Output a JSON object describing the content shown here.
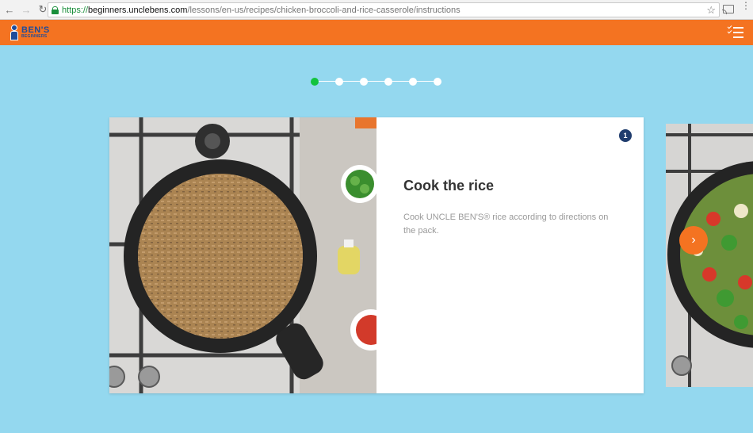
{
  "browser": {
    "back_icon": "arrow-left-icon",
    "forward_icon": "arrow-right-icon",
    "reload_icon": "reload-icon",
    "url_scheme": "https://",
    "url_host": "beginners.unclebens.com",
    "url_path": "/lessons/en-us/recipes/chicken-broccoli-and-rice-casserole/instructions",
    "bookmark_icon": "star-icon",
    "cast_icon": "cast-icon",
    "menu_icon": "more-vertical-icon"
  },
  "header": {
    "logo_main": "BEN'S",
    "logo_sub": "BEGINNERS",
    "checklist_icon": "checklist-icon",
    "brand_color": "#f47321",
    "logo_color": "#1f4c9a"
  },
  "progress": {
    "total_steps": 6,
    "current_step": 1,
    "active_color": "#13c33d"
  },
  "step": {
    "number": "1",
    "title": "Cook the rice",
    "description": "Cook UNCLE BEN'S® rice according to directions on the pack.",
    "image": "rice-in-skillet-on-stove"
  },
  "next_card": {
    "image": "vegetables-in-skillet-on-stove",
    "next_button_icon": "chevron-right-icon"
  },
  "colors": {
    "page_background": "#94d8ef",
    "badge": "#1f3c6d"
  }
}
